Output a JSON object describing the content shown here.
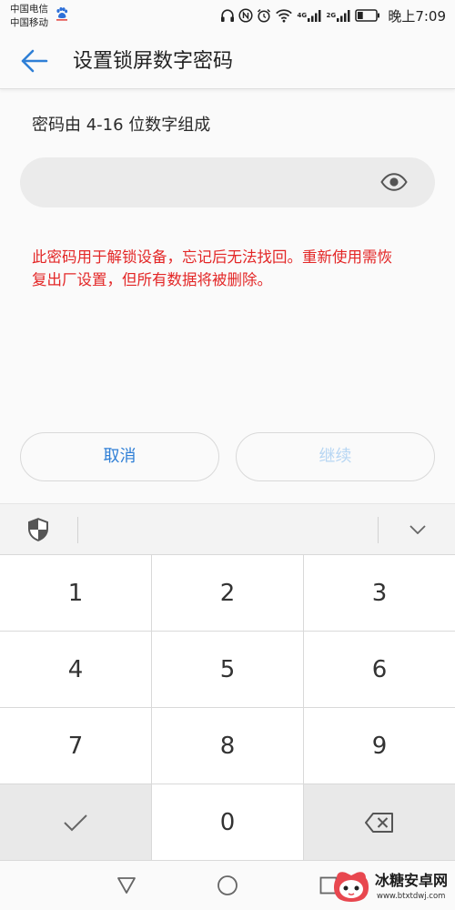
{
  "status_bar": {
    "carrier_primary": "中国电信",
    "carrier_secondary": "中国移动",
    "network_1_label": "4G",
    "network_2_label": "2G",
    "time": "晚上7:09",
    "battery_level": 0.3,
    "icons": [
      "baidu-paw-icon",
      "headphones-icon",
      "nfc-icon",
      "alarm-icon",
      "wifi-icon",
      "signal-strength-icon",
      "battery-icon"
    ]
  },
  "header": {
    "title": "设置锁屏数字密码",
    "back_icon": "back-arrow-icon"
  },
  "form": {
    "hint": "密码由 4-16 位数字组成",
    "password_value": "",
    "visibility_icon": "eye-icon",
    "warning_lines": [
      "此密码用于解锁设备，忘记后无法找回。重新使用需恢",
      "复出厂设置，但所有数据将被删除。"
    ]
  },
  "actions": {
    "cancel_label": "取消",
    "continue_label": "继续",
    "continue_enabled": false
  },
  "keyboard": {
    "toolbar_left_icon": "security-shield-icon",
    "toolbar_right_icon": "chevron-down-icon",
    "keys": [
      "1",
      "2",
      "3",
      "4",
      "5",
      "6",
      "7",
      "8",
      "9",
      "0"
    ],
    "confirm_icon": "check-icon",
    "delete_icon": "backspace-icon"
  },
  "nav_bar": {
    "icons": [
      "back-triangle-icon",
      "home-circle-icon",
      "recents-square-icon"
    ]
  },
  "watermark": {
    "name": "冰糖安卓网",
    "url": "www.btxtdwj.com"
  },
  "colors": {
    "accent": "#2f7fd6",
    "warning": "#e32626",
    "disabled": "#b7d6f3",
    "bg": "#fafafa",
    "input": "#ebebeb",
    "key": "#ffffff",
    "fnkey": "#e9e9e9"
  }
}
